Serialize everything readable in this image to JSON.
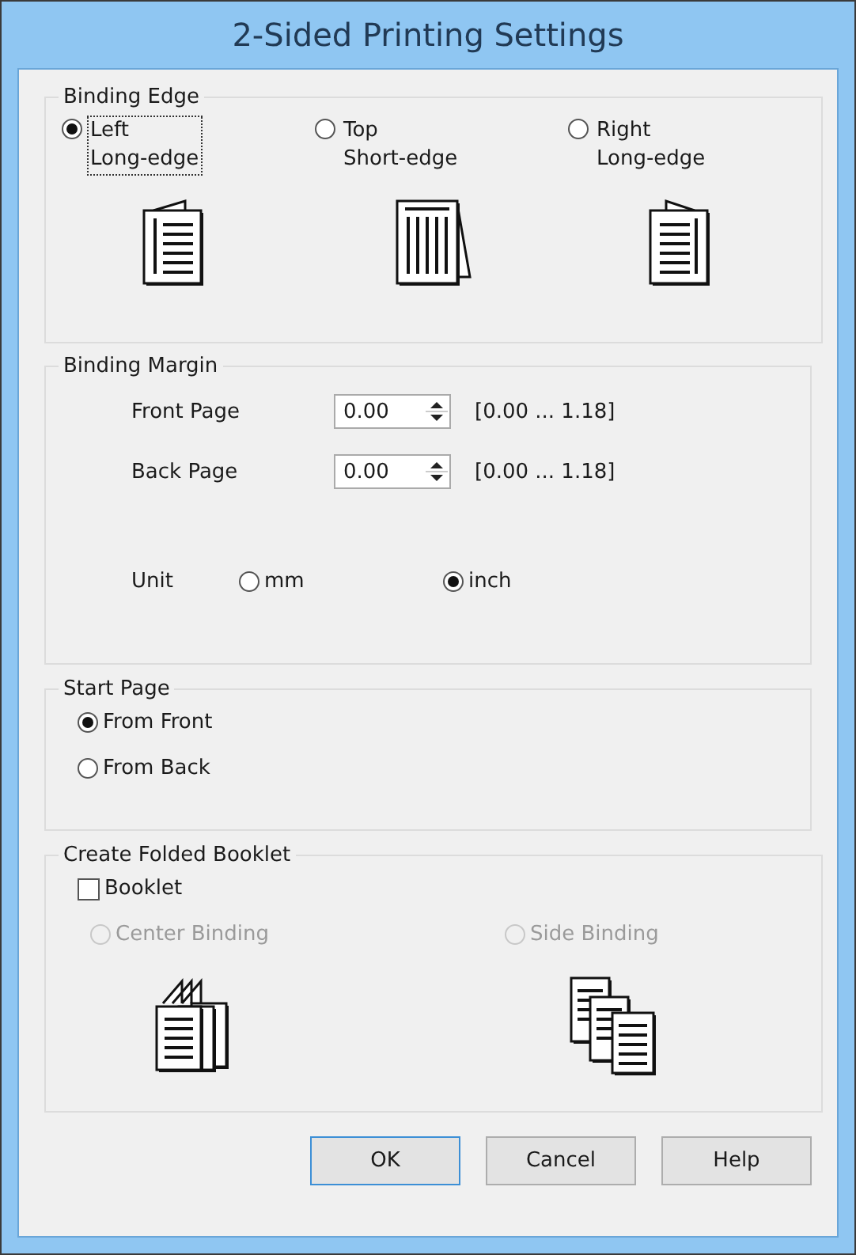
{
  "window": {
    "title": "2-Sided Printing Settings"
  },
  "binding_edge": {
    "title": "Binding Edge",
    "options": [
      {
        "label_lines": [
          "Left",
          "Long-edge"
        ],
        "selected": true,
        "focused": true,
        "kind": "left"
      },
      {
        "label_lines": [
          "Top",
          "Short-edge"
        ],
        "selected": false,
        "focused": false,
        "kind": "top"
      },
      {
        "label_lines": [
          "Right",
          "Long-edge"
        ],
        "selected": false,
        "focused": false,
        "kind": "right"
      }
    ]
  },
  "binding_margin": {
    "title": "Binding Margin",
    "fields": [
      {
        "label": "Front Page",
        "value": "0.00",
        "range": "[0.00 ... 1.18]"
      },
      {
        "label": "Back Page",
        "value": "0.00",
        "range": "[0.00 ... 1.18]"
      }
    ],
    "unit": {
      "label": "Unit",
      "options": [
        {
          "label": "mm",
          "selected": false
        },
        {
          "label": "inch",
          "selected": true
        }
      ]
    }
  },
  "start_page": {
    "title": "Start Page",
    "options": [
      {
        "label": "From Front",
        "selected": true
      },
      {
        "label": "From Back",
        "selected": false
      }
    ]
  },
  "booklet": {
    "title": "Create Folded Booklet",
    "checkbox": {
      "label": "Booklet",
      "checked": false
    },
    "options": [
      {
        "label": "Center Binding",
        "selected": false,
        "disabled": true,
        "kind": "center"
      },
      {
        "label": "Side Binding",
        "selected": false,
        "disabled": true,
        "kind": "side"
      }
    ]
  },
  "buttons": [
    {
      "label": "OK",
      "default": true
    },
    {
      "label": "Cancel",
      "default": false
    },
    {
      "label": "Help",
      "default": false
    }
  ]
}
